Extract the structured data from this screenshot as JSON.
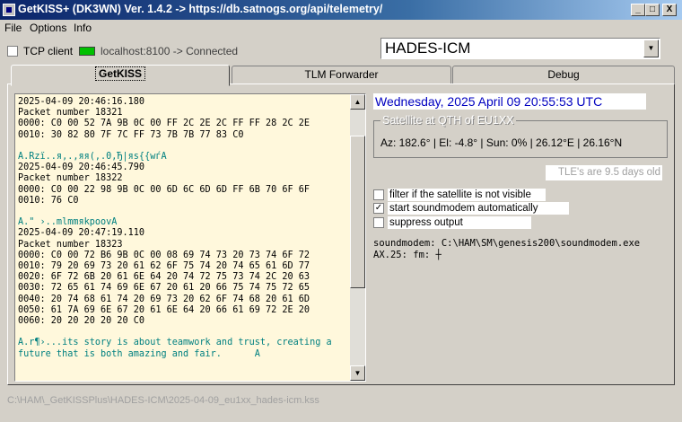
{
  "window": {
    "title": "GetKISS+ (DK3WN) Ver. 1.4.2 -> https://db.satnogs.org/api/telemetry/",
    "minimize_label": "_",
    "maximize_label": "□",
    "close_label": "X"
  },
  "menu": {
    "file": "File",
    "options": "Options",
    "info": "Info"
  },
  "connection": {
    "tcp_label": "TCP client",
    "status": "localhost:8100 -> Connected",
    "status_color": "#00c000"
  },
  "satellite": {
    "selected": "HADES-ICM",
    "dropdown_icon": "▼"
  },
  "tabs": {
    "getkiss": "GetKISS",
    "tlm": "TLM Forwarder",
    "debug": "Debug"
  },
  "log": {
    "lines": [
      "2025-04-09 20:46:16.180",
      "Packet number 18321",
      "0000: C0 00 52 7A 9B 0C 00 FF 2C 2E 2C FF FF 28 2C 2E",
      "0010: 30 82 80 7F 7C FF 73 7B 7B 77 83 C0",
      "",
      "A.Rzї..я,.,яя(,.0,Ђ|яs{{wѓA",
      "2025-04-09 20:46:45.790",
      "Packet number 18322",
      "0000: C0 00 22 98 9B 0C 00 6D 6C 6D 6D FF 6B 70 6F 6F",
      "0010: 76 C0",
      "",
      "A.\" ›..mlmmяkpoovA",
      "2025-04-09 20:47:19.110",
      "Packet number 18323",
      "0000: C0 00 72 B6 9B 0C 00 08 69 74 73 20 73 74 6F 72",
      "0010: 79 20 69 73 20 61 62 6F 75 74 20 74 65 61 6D 77",
      "0020: 6F 72 6B 20 61 6E 64 20 74 72 75 73 74 2C 20 63",
      "0030: 72 65 61 74 69 6E 67 20 61 20 66 75 74 75 72 65",
      "0040: 20 74 68 61 74 20 69 73 20 62 6F 74 68 20 61 6D",
      "0050: 61 7A 69 6E 67 20 61 6E 64 20 66 61 69 72 2E 20",
      "0060: 20 20 20 20 20 C0",
      "",
      "A.r¶›...its story is about teamwork and trust, creating a",
      "future that is both amazing and fair.      A"
    ]
  },
  "right": {
    "datetime": "Wednesday, 2025 April 09  20:55:53 UTC",
    "qth_title": "Satellite at QTH of EU1XX",
    "qth_info": "Az: 182.6° | El: -4.8° | Sun: 0% | 26.12°E | 26.16°N",
    "tle_age": "TLE's are 9.5 days old",
    "options": [
      {
        "label": "filter if the satellite is not visible",
        "checked": false
      },
      {
        "label": "start soundmodem automatically",
        "checked": true
      },
      {
        "label": "suppress output",
        "checked": false
      }
    ],
    "soundmodem": "soundmodem: C:\\HAM\\SM\\genesis200\\soundmodem.exe",
    "ax25": "AX.25: fm: ┼"
  },
  "status": {
    "path": "C:\\HAM\\_GetKISSPlus\\HADES-ICM\\2025-04-09_eu1xx_hades-icm.kss"
  },
  "scroll": {
    "up": "▲",
    "down": "▼"
  }
}
